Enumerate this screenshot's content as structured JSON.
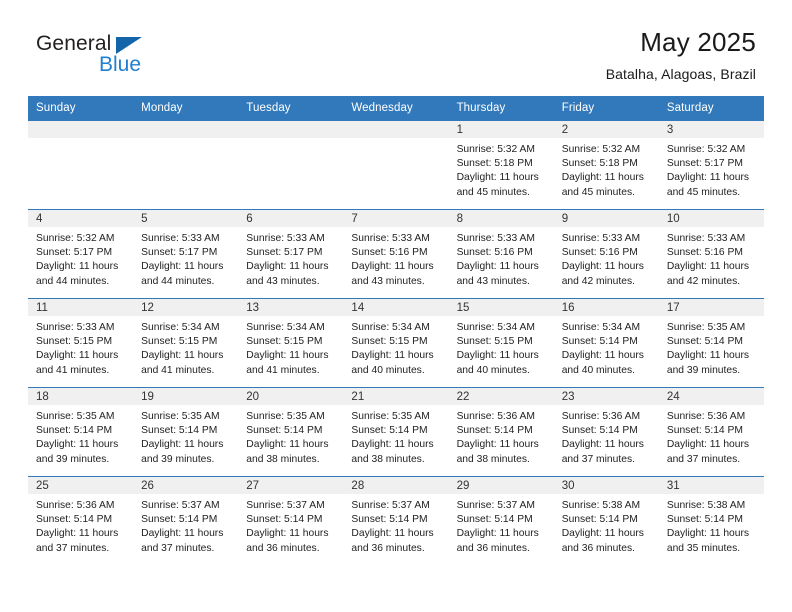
{
  "logo": {
    "word1": "General",
    "word2": "Blue",
    "triangle": "triangle-mark",
    "blue": "#1f7fd0",
    "dark": "#231f20"
  },
  "header": {
    "title": "May 2025",
    "subtitle": "Batalha, Alagoas, Brazil"
  },
  "theme": {
    "header_bg": "#3279bb",
    "daynum_bg": "#f0f0f0",
    "row_border": "#3279bb"
  },
  "weekday_headers": [
    "Sunday",
    "Monday",
    "Tuesday",
    "Wednesday",
    "Thursday",
    "Friday",
    "Saturday"
  ],
  "weeks": [
    [
      {
        "empty": true
      },
      {
        "empty": true
      },
      {
        "empty": true
      },
      {
        "empty": true
      },
      {
        "day": "1",
        "sunrise": "Sunrise: 5:32 AM",
        "sunset": "Sunset: 5:18 PM",
        "daylight1": "Daylight: 11 hours",
        "daylight2": "and 45 minutes."
      },
      {
        "day": "2",
        "sunrise": "Sunrise: 5:32 AM",
        "sunset": "Sunset: 5:18 PM",
        "daylight1": "Daylight: 11 hours",
        "daylight2": "and 45 minutes."
      },
      {
        "day": "3",
        "sunrise": "Sunrise: 5:32 AM",
        "sunset": "Sunset: 5:17 PM",
        "daylight1": "Daylight: 11 hours",
        "daylight2": "and 45 minutes."
      }
    ],
    [
      {
        "day": "4",
        "sunrise": "Sunrise: 5:32 AM",
        "sunset": "Sunset: 5:17 PM",
        "daylight1": "Daylight: 11 hours",
        "daylight2": "and 44 minutes."
      },
      {
        "day": "5",
        "sunrise": "Sunrise: 5:33 AM",
        "sunset": "Sunset: 5:17 PM",
        "daylight1": "Daylight: 11 hours",
        "daylight2": "and 44 minutes."
      },
      {
        "day": "6",
        "sunrise": "Sunrise: 5:33 AM",
        "sunset": "Sunset: 5:17 PM",
        "daylight1": "Daylight: 11 hours",
        "daylight2": "and 43 minutes."
      },
      {
        "day": "7",
        "sunrise": "Sunrise: 5:33 AM",
        "sunset": "Sunset: 5:16 PM",
        "daylight1": "Daylight: 11 hours",
        "daylight2": "and 43 minutes."
      },
      {
        "day": "8",
        "sunrise": "Sunrise: 5:33 AM",
        "sunset": "Sunset: 5:16 PM",
        "daylight1": "Daylight: 11 hours",
        "daylight2": "and 43 minutes."
      },
      {
        "day": "9",
        "sunrise": "Sunrise: 5:33 AM",
        "sunset": "Sunset: 5:16 PM",
        "daylight1": "Daylight: 11 hours",
        "daylight2": "and 42 minutes."
      },
      {
        "day": "10",
        "sunrise": "Sunrise: 5:33 AM",
        "sunset": "Sunset: 5:16 PM",
        "daylight1": "Daylight: 11 hours",
        "daylight2": "and 42 minutes."
      }
    ],
    [
      {
        "day": "11",
        "sunrise": "Sunrise: 5:33 AM",
        "sunset": "Sunset: 5:15 PM",
        "daylight1": "Daylight: 11 hours",
        "daylight2": "and 41 minutes."
      },
      {
        "day": "12",
        "sunrise": "Sunrise: 5:34 AM",
        "sunset": "Sunset: 5:15 PM",
        "daylight1": "Daylight: 11 hours",
        "daylight2": "and 41 minutes."
      },
      {
        "day": "13",
        "sunrise": "Sunrise: 5:34 AM",
        "sunset": "Sunset: 5:15 PM",
        "daylight1": "Daylight: 11 hours",
        "daylight2": "and 41 minutes."
      },
      {
        "day": "14",
        "sunrise": "Sunrise: 5:34 AM",
        "sunset": "Sunset: 5:15 PM",
        "daylight1": "Daylight: 11 hours",
        "daylight2": "and 40 minutes."
      },
      {
        "day": "15",
        "sunrise": "Sunrise: 5:34 AM",
        "sunset": "Sunset: 5:15 PM",
        "daylight1": "Daylight: 11 hours",
        "daylight2": "and 40 minutes."
      },
      {
        "day": "16",
        "sunrise": "Sunrise: 5:34 AM",
        "sunset": "Sunset: 5:14 PM",
        "daylight1": "Daylight: 11 hours",
        "daylight2": "and 40 minutes."
      },
      {
        "day": "17",
        "sunrise": "Sunrise: 5:35 AM",
        "sunset": "Sunset: 5:14 PM",
        "daylight1": "Daylight: 11 hours",
        "daylight2": "and 39 minutes."
      }
    ],
    [
      {
        "day": "18",
        "sunrise": "Sunrise: 5:35 AM",
        "sunset": "Sunset: 5:14 PM",
        "daylight1": "Daylight: 11 hours",
        "daylight2": "and 39 minutes."
      },
      {
        "day": "19",
        "sunrise": "Sunrise: 5:35 AM",
        "sunset": "Sunset: 5:14 PM",
        "daylight1": "Daylight: 11 hours",
        "daylight2": "and 39 minutes."
      },
      {
        "day": "20",
        "sunrise": "Sunrise: 5:35 AM",
        "sunset": "Sunset: 5:14 PM",
        "daylight1": "Daylight: 11 hours",
        "daylight2": "and 38 minutes."
      },
      {
        "day": "21",
        "sunrise": "Sunrise: 5:35 AM",
        "sunset": "Sunset: 5:14 PM",
        "daylight1": "Daylight: 11 hours",
        "daylight2": "and 38 minutes."
      },
      {
        "day": "22",
        "sunrise": "Sunrise: 5:36 AM",
        "sunset": "Sunset: 5:14 PM",
        "daylight1": "Daylight: 11 hours",
        "daylight2": "and 38 minutes."
      },
      {
        "day": "23",
        "sunrise": "Sunrise: 5:36 AM",
        "sunset": "Sunset: 5:14 PM",
        "daylight1": "Daylight: 11 hours",
        "daylight2": "and 37 minutes."
      },
      {
        "day": "24",
        "sunrise": "Sunrise: 5:36 AM",
        "sunset": "Sunset: 5:14 PM",
        "daylight1": "Daylight: 11 hours",
        "daylight2": "and 37 minutes."
      }
    ],
    [
      {
        "day": "25",
        "sunrise": "Sunrise: 5:36 AM",
        "sunset": "Sunset: 5:14 PM",
        "daylight1": "Daylight: 11 hours",
        "daylight2": "and 37 minutes."
      },
      {
        "day": "26",
        "sunrise": "Sunrise: 5:37 AM",
        "sunset": "Sunset: 5:14 PM",
        "daylight1": "Daylight: 11 hours",
        "daylight2": "and 37 minutes."
      },
      {
        "day": "27",
        "sunrise": "Sunrise: 5:37 AM",
        "sunset": "Sunset: 5:14 PM",
        "daylight1": "Daylight: 11 hours",
        "daylight2": "and 36 minutes."
      },
      {
        "day": "28",
        "sunrise": "Sunrise: 5:37 AM",
        "sunset": "Sunset: 5:14 PM",
        "daylight1": "Daylight: 11 hours",
        "daylight2": "and 36 minutes."
      },
      {
        "day": "29",
        "sunrise": "Sunrise: 5:37 AM",
        "sunset": "Sunset: 5:14 PM",
        "daylight1": "Daylight: 11 hours",
        "daylight2": "and 36 minutes."
      },
      {
        "day": "30",
        "sunrise": "Sunrise: 5:38 AM",
        "sunset": "Sunset: 5:14 PM",
        "daylight1": "Daylight: 11 hours",
        "daylight2": "and 36 minutes."
      },
      {
        "day": "31",
        "sunrise": "Sunrise: 5:38 AM",
        "sunset": "Sunset: 5:14 PM",
        "daylight1": "Daylight: 11 hours",
        "daylight2": "and 35 minutes."
      }
    ]
  ]
}
